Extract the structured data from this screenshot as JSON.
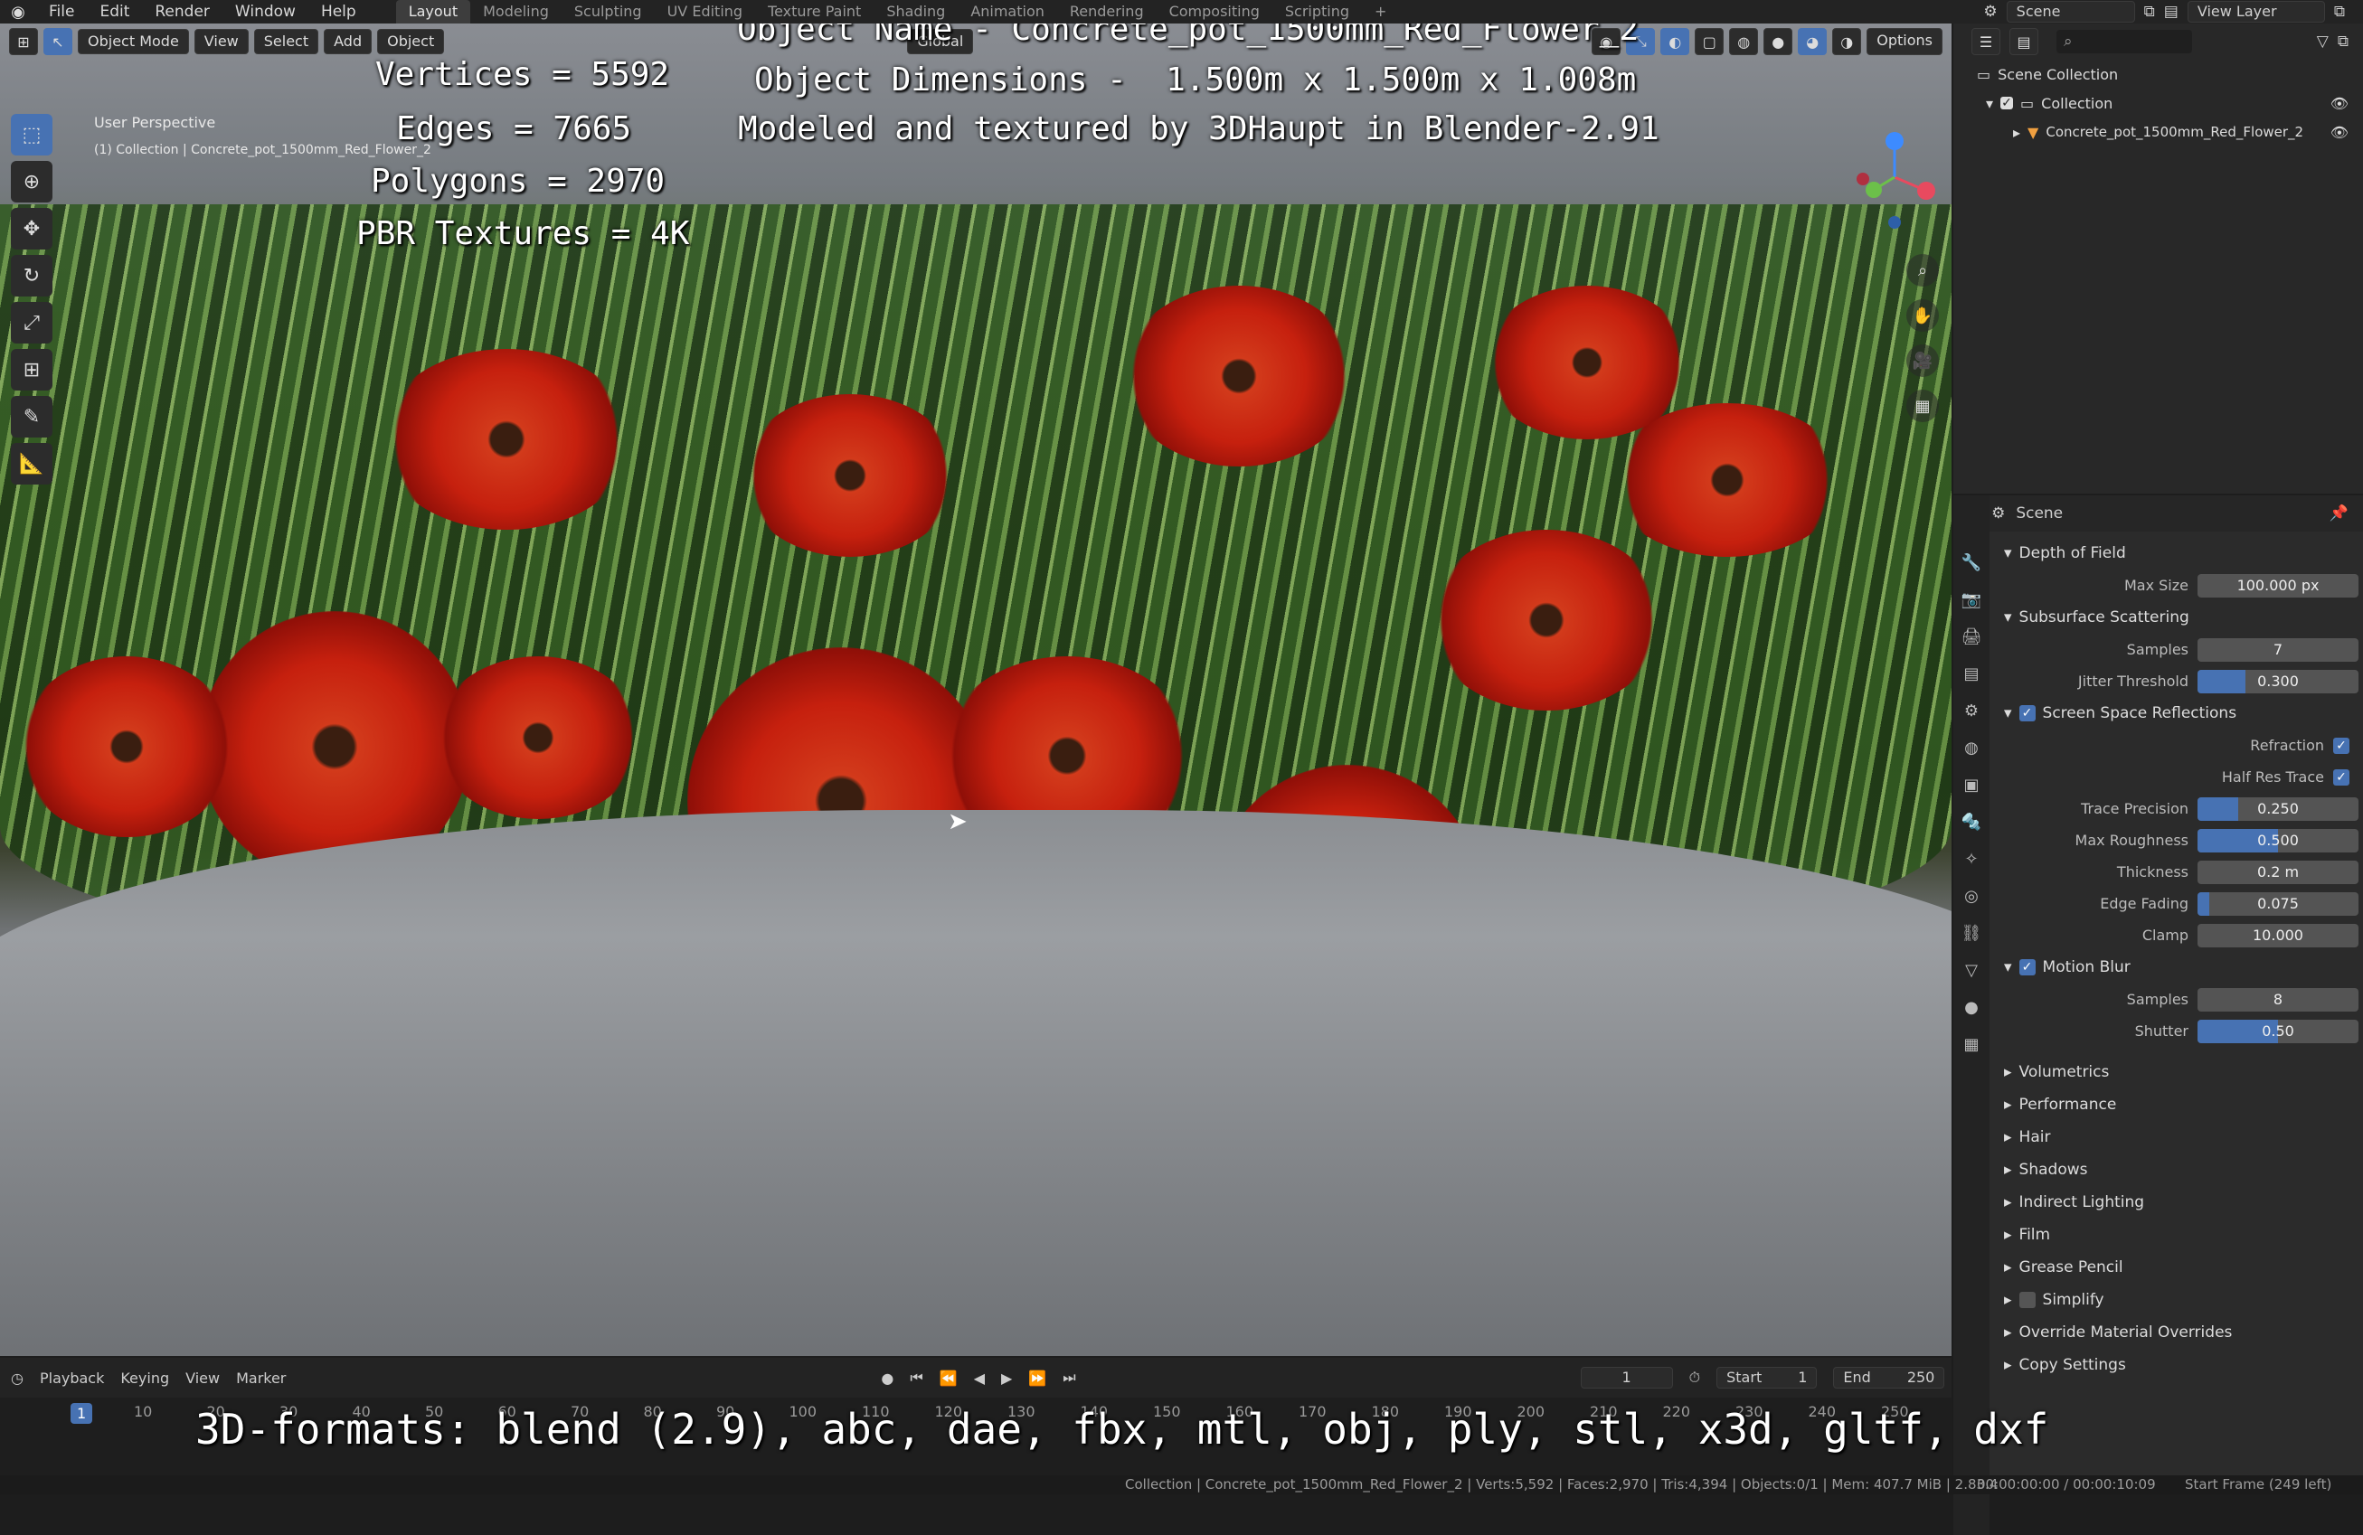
{
  "menu": {
    "items": [
      "File",
      "Edit",
      "Render",
      "Window",
      "Help"
    ],
    "workspaces": [
      "Layout",
      "Modeling",
      "Sculpting",
      "UV Editing",
      "Texture Paint",
      "Shading",
      "Animation",
      "Rendering",
      "Compositing",
      "Scripting"
    ],
    "add_tab": "+",
    "scene_label": "Scene",
    "view_layer_label": "View Layer"
  },
  "viewport": {
    "mode": "Object Mode",
    "menus": [
      "View",
      "Select",
      "Add",
      "Object"
    ],
    "orientation": "Global",
    "options_label": "Options",
    "perspective_label": "User Perspective",
    "collection_label": "(1) Collection | Concrete_pot_1500mm_Red_Flower_2"
  },
  "overlay": {
    "stats": [
      "Vertices = 5592",
      "Edges = 7665",
      "Polygons = 2970",
      "PBR Textures = 4K"
    ],
    "object_name": "Object Name - Concrete_pot_1500mm_Red_Flower_2",
    "dimensions": "Object Dimensions -  1.500m x 1.500m x 1.008m",
    "credit": "Modeled and textured by 3DHaupt in Blender-2.91",
    "formats": "3D-formats: blend (2.9), abc, dae, fbx, mtl, obj, ply, stl, x3d, gltf, dxf"
  },
  "outliner": {
    "root": "Scene Collection",
    "collection": "Collection",
    "object": "Concrete_pot_1500mm_Red_Flower_2"
  },
  "properties": {
    "context": "Scene",
    "dof": {
      "title": "Depth of Field",
      "max_size_label": "Max Size",
      "max_size": "100.000 px"
    },
    "sss": {
      "title": "Subsurface Scattering",
      "samples_label": "Samples",
      "samples": "7",
      "jitter_label": "Jitter Threshold",
      "jitter": "0.300",
      "jitter_fill": 0.3
    },
    "ssr": {
      "title": "Screen Space Reflections",
      "refraction_label": "Refraction",
      "half_res_label": "Half Res Trace",
      "trace_label": "Trace Precision",
      "trace": "0.250",
      "trace_fill": 0.25,
      "roughness_label": "Max Roughness",
      "roughness": "0.500",
      "roughness_fill": 0.5,
      "thickness_label": "Thickness",
      "thickness": "0.2 m",
      "edge_label": "Edge Fading",
      "edge": "0.075",
      "edge_fill": 0.075,
      "clamp_label": "Clamp",
      "clamp": "10.000"
    },
    "motion_blur": {
      "title": "Motion Blur",
      "samples_label": "Samples",
      "samples": "8",
      "shutter_label": "Shutter",
      "shutter": "0.50",
      "shutter_fill": 0.5
    },
    "collapsed": [
      "Volumetrics",
      "Performance",
      "Hair",
      "Shadows",
      "Indirect Lighting",
      "Film",
      "Grease Pencil",
      "Simplify",
      "Override Material Overrides",
      "Copy Settings"
    ]
  },
  "timeline": {
    "menus": [
      "Playback",
      "Keying",
      "View",
      "Marker"
    ],
    "current_frame": "1",
    "start_label": "Start",
    "start": "1",
    "end_label": "End",
    "end": "250",
    "ruler": [
      "1",
      "10",
      "20",
      "30",
      "40",
      "50",
      "60",
      "70",
      "80",
      "90",
      "100",
      "110",
      "120",
      "130",
      "140",
      "150",
      "160",
      "170",
      "180",
      "190",
      "200",
      "210",
      "220",
      "230",
      "240",
      "250"
    ]
  },
  "status": {
    "info": "Collection | Concrete_pot_1500mm_Red_Flower_2 | Verts:5,592 | Faces:2,970 | Tris:4,394 | Objects:0/1 | Mem: 407.7 MiB | 2.83.4",
    "time": "00:00:00:00 / 00:00:10:09",
    "frame": "Start Frame (249 left)"
  }
}
